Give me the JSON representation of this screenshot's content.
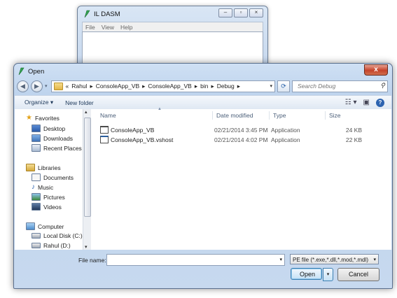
{
  "background_window": {
    "title": "IL DASM",
    "menu": [
      "File",
      "View",
      "Help"
    ],
    "controls": [
      "minimize",
      "maximize",
      "close"
    ]
  },
  "dialog": {
    "title": "Open",
    "close_glyph": "x",
    "breadcrumb": [
      "«",
      "Rahul",
      "ConsoleApp_VB",
      "ConsoleApp_VB",
      "bin",
      "Debug"
    ],
    "search_placeholder": "Search Debug",
    "toolbar": {
      "organize": "Organize ▾",
      "new_folder": "New folder"
    },
    "nav": {
      "favorites_label": "Favorites",
      "favorites": [
        "Desktop",
        "Downloads",
        "Recent Places"
      ],
      "libraries_label": "Libraries",
      "libraries": [
        "Documents",
        "Music",
        "Pictures",
        "Videos"
      ],
      "computer_label": "Computer",
      "drives": [
        "Local Disk (C:)",
        "Rahul (D:)"
      ]
    },
    "columns": {
      "name": "Name",
      "date": "Date modified",
      "type": "Type",
      "size": "Size"
    },
    "files": [
      {
        "name": "ConsoleApp_VB",
        "date": "02/21/2014 3:45 PM",
        "type": "Application",
        "size": "24 KB",
        "icon": "application-icon"
      },
      {
        "name": "ConsoleApp_VB.vshost",
        "date": "02/21/2014 4:02 PM",
        "type": "Application",
        "size": "22 KB",
        "icon": "vshost-application-icon"
      }
    ],
    "filename_label": "File name:",
    "filename_value": "",
    "filter": "PE file (*.exe,*.dll,*.mod,*.mdl)",
    "open_label": "Open",
    "cancel_label": "Cancel"
  },
  "colors": {
    "title_close": "#c5432a",
    "accent": "#2c63b0",
    "chrome": "#bcd2ec"
  }
}
